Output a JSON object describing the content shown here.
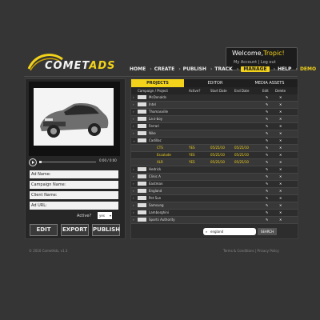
{
  "brand": {
    "name_primary": "COMET",
    "name_secondary": "ADS"
  },
  "welcome": {
    "greeting": "Welcome,",
    "name": "Tropic!",
    "links": "My Account | Log out"
  },
  "nav": {
    "items": [
      "HOME",
      "CREATE",
      "PUBLISH",
      "TRACK",
      "MANAGE",
      "HELP",
      "DEMO"
    ],
    "active": "MANAGE"
  },
  "media": {
    "time": "0:00 / 0:00"
  },
  "form": {
    "ad_name": "Ad Name:",
    "campaign_name": "Campaign Name:",
    "client_name": "Client Name:",
    "ad_url": "Ad URL:",
    "active_label": "Active?",
    "active_value": "yes",
    "buttons": [
      "EDIT",
      "EXPORT",
      "PUBLISH"
    ]
  },
  "tabs": [
    "PROJECTS",
    "EDITOR",
    "MEDIA ASSETS"
  ],
  "table": {
    "headers": [
      "Campaign / Project",
      "Active?",
      "Start Date",
      "End Date",
      "Edit",
      "Delete"
    ],
    "rows": [
      {
        "name": "McDonalds",
        "child": false,
        "active": "",
        "start": "",
        "end": ""
      },
      {
        "name": "Intel",
        "child": false,
        "active": "",
        "start": "",
        "end": ""
      },
      {
        "name": "Thomasville",
        "child": false,
        "active": "",
        "start": "",
        "end": ""
      },
      {
        "name": "La-z-boy",
        "child": false,
        "active": "",
        "start": "",
        "end": ""
      },
      {
        "name": "Ferrari",
        "child": false,
        "active": "",
        "start": "",
        "end": ""
      },
      {
        "name": "Nike",
        "child": false,
        "active": "",
        "start": "",
        "end": ""
      },
      {
        "name": "Cadillac",
        "child": false,
        "active": "",
        "start": "",
        "end": ""
      },
      {
        "name": "CTS",
        "child": true,
        "active": "YES",
        "start": "05/25/10",
        "end": "05/25/10"
      },
      {
        "name": "Escalade",
        "child": true,
        "active": "YES",
        "start": "05/25/10",
        "end": "05/25/10"
      },
      {
        "name": "XLR",
        "child": true,
        "active": "YES",
        "start": "05/25/10",
        "end": "05/25/10"
      },
      {
        "name": "Hedrick",
        "child": false,
        "active": "",
        "start": "",
        "end": ""
      },
      {
        "name": "Clinic A",
        "child": false,
        "active": "",
        "start": "",
        "end": ""
      },
      {
        "name": "Eastman",
        "child": false,
        "active": "",
        "start": "",
        "end": ""
      },
      {
        "name": "England",
        "child": false,
        "active": "",
        "start": "",
        "end": ""
      },
      {
        "name": "Pet Sun",
        "child": false,
        "active": "",
        "start": "",
        "end": ""
      },
      {
        "name": "Samsung",
        "child": false,
        "active": "",
        "start": "",
        "end": ""
      },
      {
        "name": "Lamborghini",
        "child": false,
        "active": "",
        "start": "",
        "end": ""
      },
      {
        "name": "Sports Authority",
        "child": false,
        "active": "",
        "start": "",
        "end": ""
      }
    ]
  },
  "search": {
    "value": "england",
    "button": "SEARCH"
  },
  "footer": {
    "left": "© 2010 CometAds, v1.3",
    "right": "Terms & Conditions | Privacy Policy"
  }
}
